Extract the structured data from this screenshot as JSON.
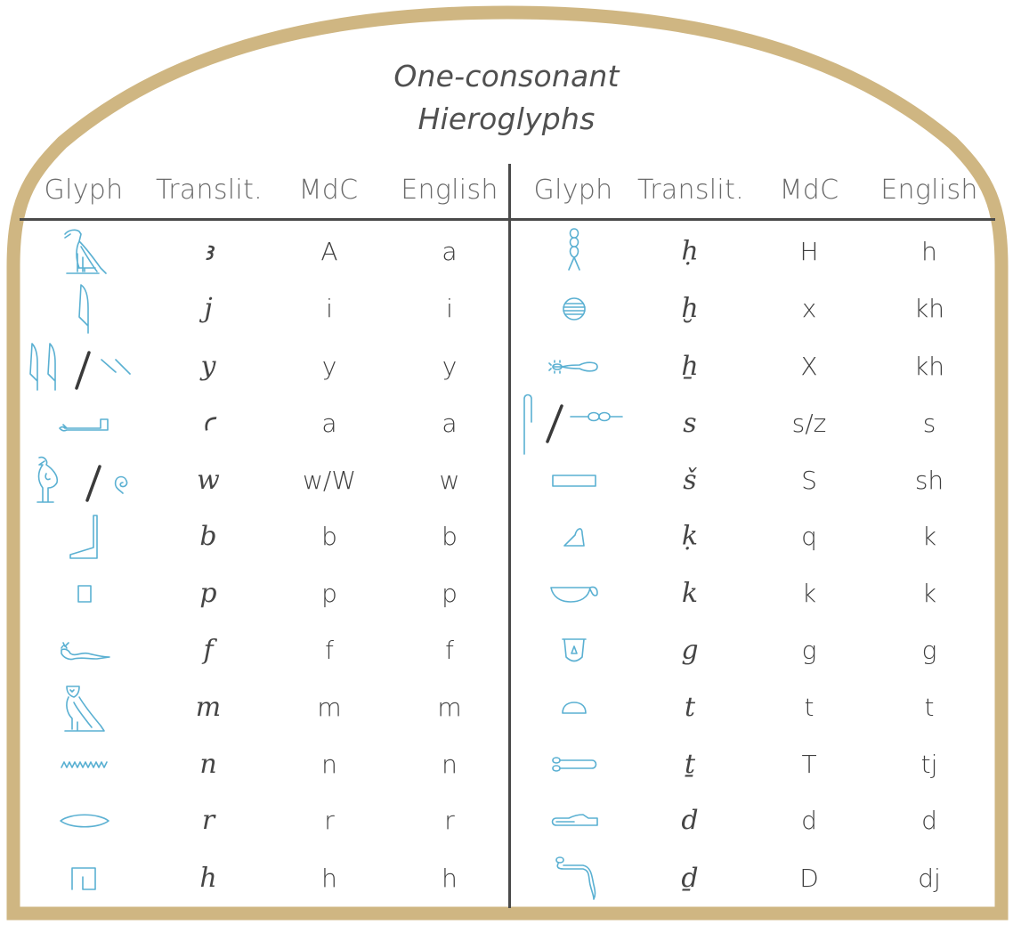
{
  "title": {
    "line1": "One-consonant",
    "line2": "Hieroglyphs"
  },
  "colors": {
    "frame": "#CFB682",
    "glyph": "#5AB0D2",
    "text": "#454545",
    "rule": "#4A4A4A"
  },
  "columns": [
    "Glyph",
    "Translit.",
    "MdC",
    "English"
  ],
  "left_rows": [
    {
      "glyph": "egyptian-vulture-icon",
      "translit": "ꜣ",
      "mdc": "A",
      "english": "a"
    },
    {
      "glyph": "reed-leaf-icon",
      "translit": "j",
      "mdc": "i",
      "english": "i"
    },
    {
      "glyph": "double-reed-or-strokes-icon",
      "translit": "y",
      "mdc": "y",
      "english": "y"
    },
    {
      "glyph": "forearm-icon",
      "translit": "ꜥ",
      "mdc": "a",
      "english": "a"
    },
    {
      "glyph": "quail-chick-or-coil-icon",
      "translit": "w",
      "mdc": "w/W",
      "english": "w"
    },
    {
      "glyph": "foot-icon",
      "translit": "b",
      "mdc": "b",
      "english": "b"
    },
    {
      "glyph": "stool-icon",
      "translit": "p",
      "mdc": "p",
      "english": "p"
    },
    {
      "glyph": "horned-viper-icon",
      "translit": "f",
      "mdc": "f",
      "english": "f"
    },
    {
      "glyph": "owl-icon",
      "translit": "m",
      "mdc": "m",
      "english": "m"
    },
    {
      "glyph": "water-ripple-icon",
      "translit": "n",
      "mdc": "n",
      "english": "n"
    },
    {
      "glyph": "mouth-icon",
      "translit": "r",
      "mdc": "r",
      "english": "r"
    },
    {
      "glyph": "reed-shelter-icon",
      "translit": "h",
      "mdc": "h",
      "english": "h"
    }
  ],
  "right_rows": [
    {
      "glyph": "twisted-wick-icon",
      "translit": "ḥ",
      "mdc": "H",
      "english": "h"
    },
    {
      "glyph": "placenta-icon",
      "translit": "ḫ",
      "mdc": "x",
      "english": "kh"
    },
    {
      "glyph": "animal-belly-icon",
      "translit": "ẖ",
      "mdc": "X",
      "english": "kh"
    },
    {
      "glyph": "folded-cloth-or-door-bolt-icon",
      "translit": "s",
      "mdc": "s/z",
      "english": "s"
    },
    {
      "glyph": "pool-icon",
      "translit": "š",
      "mdc": "S",
      "english": "sh"
    },
    {
      "glyph": "hill-slope-icon",
      "translit": "ḳ",
      "mdc": "q",
      "english": "k"
    },
    {
      "glyph": "basket-with-handle-icon",
      "translit": "k",
      "mdc": "k",
      "english": "k"
    },
    {
      "glyph": "jar-stand-icon",
      "translit": "g",
      "mdc": "g",
      "english": "g"
    },
    {
      "glyph": "bread-loaf-icon",
      "translit": "t",
      "mdc": "t",
      "english": "t"
    },
    {
      "glyph": "tethering-rope-icon",
      "translit": "ṯ",
      "mdc": "T",
      "english": "tj"
    },
    {
      "glyph": "hand-icon",
      "translit": "d",
      "mdc": "d",
      "english": "d"
    },
    {
      "glyph": "cobra-icon",
      "translit": "ḏ",
      "mdc": "D",
      "english": "dj"
    }
  ]
}
